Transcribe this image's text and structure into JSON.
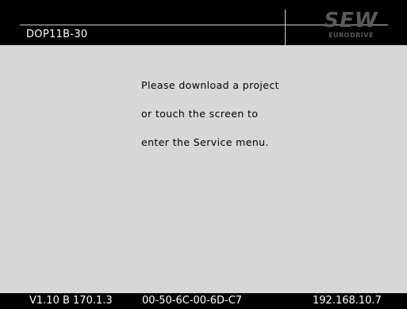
{
  "header": {
    "device_name": "DOP11B-30",
    "logo_text": "SEW",
    "logo_subtext": "EURODRIVE"
  },
  "message": {
    "lines": [
      "Please download a project",
      "or touch the screen to",
      "enter the Service menu."
    ]
  },
  "footer": {
    "version": "V1.10 B 170.1.3",
    "mac_address": "00-50-6C-00-6D-C7",
    "ip_address": "192.168.10.7"
  },
  "colors": {
    "bar": "#000000",
    "background": "#d7d7d7",
    "text_light": "#ffffff",
    "logo": "#5a5a5a"
  }
}
